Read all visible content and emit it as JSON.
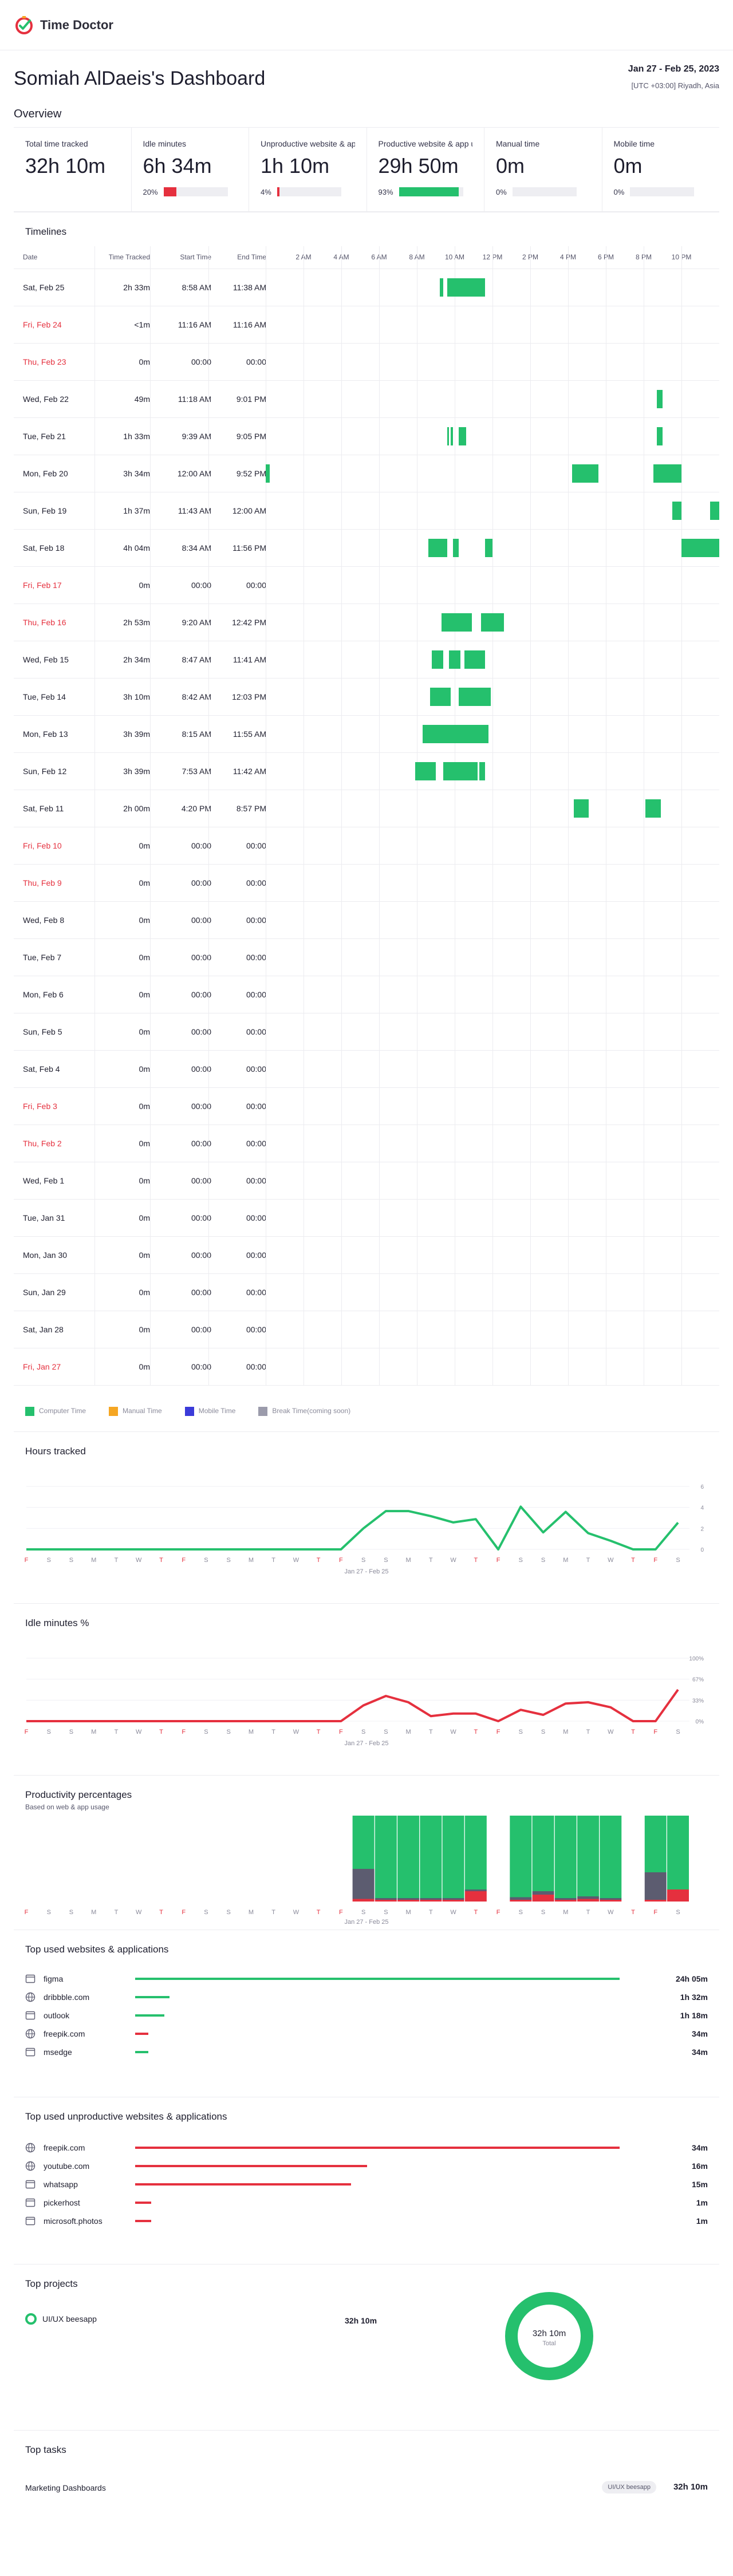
{
  "app": {
    "name": "Time Doctor"
  },
  "header": {
    "title": "Somiah AlDaeis's Dashboard",
    "date_range": "Jan 27 - Feb 25, 2023",
    "timezone": "[UTC +03:00] Riyadh, Asia"
  },
  "overview": {
    "title": "Overview",
    "cards": [
      {
        "label": "Total time tracked",
        "value": "32h 10m"
      },
      {
        "label": "Idle minutes",
        "value": "6h 34m",
        "pct": "20%",
        "fill": 0.2,
        "color": "#e5303e"
      },
      {
        "label": "Unproductive website & apps",
        "value": "1h 10m",
        "pct": "4%",
        "fill": 0.04,
        "color": "#e5303e"
      },
      {
        "label": "Productive website & app usage",
        "value": "29h 50m",
        "pct": "93%",
        "fill": 0.93,
        "color": "#25c06d"
      },
      {
        "label": "Manual time",
        "value": "0m",
        "pct": "0%",
        "fill": 0,
        "color": "#e5303e"
      },
      {
        "label": "Mobile time",
        "value": "0m",
        "pct": "0%",
        "fill": 0,
        "color": "#e5303e"
      }
    ]
  },
  "timelines": {
    "title": "Timelines",
    "columns": [
      "Date",
      "Time Tracked",
      "Start Time",
      "End Time"
    ],
    "hours": [
      "2 AM",
      "4 AM",
      "6 AM",
      "8 AM",
      "10 AM",
      "12 PM",
      "2 PM",
      "4 PM",
      "6 PM",
      "8 PM",
      "10 PM"
    ],
    "rows": [
      {
        "date": "Sat, Feb 25",
        "tracked": "2h 33m",
        "start": "8:58 AM",
        "end": "11:38 AM",
        "weekend": false
      },
      {
        "date": "Fri, Feb 24",
        "tracked": "<1m",
        "start": "11:16 AM",
        "end": "11:16 AM",
        "weekend": true
      },
      {
        "date": "Thu, Feb 23",
        "tracked": "0m",
        "start": "00:00",
        "end": "00:00",
        "weekend": true
      },
      {
        "date": "Wed, Feb 22",
        "tracked": "49m",
        "start": "11:18 AM",
        "end": "9:01 PM",
        "weekend": false
      },
      {
        "date": "Tue, Feb 21",
        "tracked": "1h 33m",
        "start": "9:39 AM",
        "end": "9:05 PM",
        "weekend": false
      },
      {
        "date": "Mon, Feb 20",
        "tracked": "3h 34m",
        "start": "12:00 AM",
        "end": "9:52 PM",
        "weekend": false
      },
      {
        "date": "Sun, Feb 19",
        "tracked": "1h 37m",
        "start": "11:43 AM",
        "end": "12:00 AM",
        "weekend": false
      },
      {
        "date": "Sat, Feb 18",
        "tracked": "4h 04m",
        "start": "8:34 AM",
        "end": "11:56 PM",
        "weekend": false
      },
      {
        "date": "Fri, Feb 17",
        "tracked": "0m",
        "start": "00:00",
        "end": "00:00",
        "weekend": true
      },
      {
        "date": "Thu, Feb 16",
        "tracked": "2h 53m",
        "start": "9:20 AM",
        "end": "12:42 PM",
        "weekend": true
      },
      {
        "date": "Wed, Feb 15",
        "tracked": "2h 34m",
        "start": "8:47 AM",
        "end": "11:41 AM",
        "weekend": false
      },
      {
        "date": "Tue, Feb 14",
        "tracked": "3h 10m",
        "start": "8:42 AM",
        "end": "12:03 PM",
        "weekend": false
      },
      {
        "date": "Mon, Feb 13",
        "tracked": "3h 39m",
        "start": "8:15 AM",
        "end": "11:55 AM",
        "weekend": false
      },
      {
        "date": "Sun, Feb 12",
        "tracked": "3h 39m",
        "start": "7:53 AM",
        "end": "11:42 AM",
        "weekend": false
      },
      {
        "date": "Sat, Feb 11",
        "tracked": "2h 00m",
        "start": "4:20 PM",
        "end": "8:57 PM",
        "weekend": false
      },
      {
        "date": "Fri, Feb 10",
        "tracked": "0m",
        "start": "00:00",
        "end": "00:00",
        "weekend": true
      },
      {
        "date": "Thu, Feb 9",
        "tracked": "0m",
        "start": "00:00",
        "end": "00:00",
        "weekend": true
      },
      {
        "date": "Wed, Feb 8",
        "tracked": "0m",
        "start": "00:00",
        "end": "00:00",
        "weekend": false
      },
      {
        "date": "Tue, Feb 7",
        "tracked": "0m",
        "start": "00:00",
        "end": "00:00",
        "weekend": false
      },
      {
        "date": "Mon, Feb 6",
        "tracked": "0m",
        "start": "00:00",
        "end": "00:00",
        "weekend": false
      },
      {
        "date": "Sun, Feb 5",
        "tracked": "0m",
        "start": "00:00",
        "end": "00:00",
        "weekend": false
      },
      {
        "date": "Sat, Feb 4",
        "tracked": "0m",
        "start": "00:00",
        "end": "00:00",
        "weekend": false
      },
      {
        "date": "Fri, Feb 3",
        "tracked": "0m",
        "start": "00:00",
        "end": "00:00",
        "weekend": true
      },
      {
        "date": "Thu, Feb 2",
        "tracked": "0m",
        "start": "00:00",
        "end": "00:00",
        "weekend": true
      },
      {
        "date": "Wed, Feb 1",
        "tracked": "0m",
        "start": "00:00",
        "end": "00:00",
        "weekend": false
      },
      {
        "date": "Tue, Jan 31",
        "tracked": "0m",
        "start": "00:00",
        "end": "00:00",
        "weekend": false
      },
      {
        "date": "Mon, Jan 30",
        "tracked": "0m",
        "start": "00:00",
        "end": "00:00",
        "weekend": false
      },
      {
        "date": "Sun, Jan 29",
        "tracked": "0m",
        "start": "00:00",
        "end": "00:00",
        "weekend": false
      },
      {
        "date": "Sat, Jan 28",
        "tracked": "0m",
        "start": "00:00",
        "end": "00:00",
        "weekend": false
      },
      {
        "date": "Fri, Jan 27",
        "tracked": "0m",
        "start": "00:00",
        "end": "00:00",
        "weekend": true
      }
    ],
    "segments": [
      [
        [
          9.2,
          9.4
        ],
        [
          9.6,
          11.6
        ]
      ],
      [],
      [],
      [
        [
          20.7,
          21.0
        ]
      ],
      [
        [
          9.6,
          9.7
        ],
        [
          9.8,
          9.9
        ],
        [
          10.2,
          10.6
        ],
        [
          20.7,
          21.0
        ]
      ],
      [
        [
          0,
          0.2
        ],
        [
          16.2,
          17.6
        ],
        [
          20.5,
          22.0
        ]
      ],
      [
        [
          21.5,
          22.0
        ],
        [
          23.5,
          24.0
        ]
      ],
      [
        [
          8.6,
          9.6
        ],
        [
          9.9,
          10.2
        ],
        [
          11.6,
          12.0
        ],
        [
          22.0,
          24.0
        ]
      ],
      [],
      [
        [
          9.3,
          10.9
        ],
        [
          11.4,
          12.6
        ]
      ],
      [
        [
          8.8,
          9.4
        ],
        [
          9.7,
          10.3
        ],
        [
          10.5,
          11.6
        ]
      ],
      [
        [
          8.7,
          9.8
        ],
        [
          10.2,
          11.9
        ]
      ],
      [
        [
          8.3,
          11.8
        ]
      ],
      [
        [
          7.9,
          9.0
        ],
        [
          9.4,
          11.2
        ],
        [
          11.3,
          11.6
        ]
      ],
      [
        [
          16.3,
          17.1
        ],
        [
          20.1,
          20.9
        ]
      ],
      [],
      [],
      [],
      [],
      [],
      [],
      [],
      [],
      [],
      [],
      [],
      [],
      [],
      [],
      []
    ],
    "legend": [
      {
        "label": "Computer Time",
        "color": "#25c06d"
      },
      {
        "label": "Manual Time",
        "color": "#f5a623"
      },
      {
        "label": "Mobile Time",
        "color": "#3b3bd9"
      },
      {
        "label": "Break Time(coming soon)",
        "color": "#9b9bab"
      }
    ]
  },
  "hours_tracked": {
    "title": "Hours tracked",
    "caption": "Jan 27 - Feb 25"
  },
  "idle_minutes": {
    "title": "Idle minutes %",
    "caption": "Jan 27 - Feb 25"
  },
  "productivity": {
    "title": "Productivity percentages",
    "subtitle": "Based on web & app usage",
    "caption": "Jan 27 - Feb 25"
  },
  "chart_data": [
    {
      "type": "line",
      "title": "Hours tracked",
      "x": [
        "F",
        "S",
        "S",
        "M",
        "T",
        "W",
        "T",
        "F",
        "S",
        "S",
        "M",
        "T",
        "W",
        "T",
        "F",
        "S",
        "S",
        "M",
        "T",
        "W",
        "T",
        "F",
        "S",
        "S",
        "M",
        "T",
        "W",
        "T",
        "F",
        "S"
      ],
      "red_days": [
        0,
        6,
        7,
        13,
        14,
        20,
        21,
        27,
        28
      ],
      "values": [
        0,
        0,
        0,
        0,
        0,
        0,
        0,
        0,
        0,
        0,
        0,
        0,
        0,
        0,
        0,
        2.0,
        3.65,
        3.65,
        3.17,
        2.57,
        2.88,
        0,
        4.07,
        1.62,
        3.57,
        1.55,
        0.82,
        0,
        0,
        2.55
      ],
      "yticks": [
        0,
        2,
        4,
        6
      ],
      "ylim": [
        0,
        6
      ],
      "color": "#25c06d"
    },
    {
      "type": "line",
      "title": "Idle minutes %",
      "x": [
        "F",
        "S",
        "S",
        "M",
        "T",
        "W",
        "T",
        "F",
        "S",
        "S",
        "M",
        "T",
        "W",
        "T",
        "F",
        "S",
        "S",
        "M",
        "T",
        "W",
        "T",
        "F",
        "S",
        "S",
        "M",
        "T",
        "W",
        "T",
        "F",
        "S"
      ],
      "red_days": [
        0,
        6,
        7,
        13,
        14,
        20,
        21,
        27,
        28
      ],
      "values": [
        0,
        0,
        0,
        0,
        0,
        0,
        0,
        0,
        0,
        0,
        0,
        0,
        0,
        0,
        0,
        25,
        40,
        30,
        8,
        12,
        12,
        0,
        18,
        10,
        28,
        30,
        22,
        0,
        0,
        50
      ],
      "yticks": [
        "0%",
        "33%",
        "67%",
        "100%"
      ],
      "ylim": [
        0,
        100
      ],
      "color": "#e5303e"
    },
    {
      "type": "bar",
      "title": "Productivity percentages",
      "x": [
        "F",
        "S",
        "S",
        "M",
        "T",
        "W",
        "T",
        "F",
        "S",
        "S",
        "M",
        "T",
        "W",
        "T",
        "F",
        "S",
        "S",
        "M",
        "T",
        "W",
        "T",
        "F",
        "S",
        "S",
        "M",
        "T",
        "W",
        "T",
        "F",
        "S"
      ],
      "red_days": [
        0,
        6,
        7,
        13,
        14,
        20,
        21,
        27,
        28
      ],
      "series": [
        {
          "name": "productive",
          "color": "#25c06d",
          "values": [
            0,
            0,
            0,
            0,
            0,
            0,
            0,
            0,
            0,
            0,
            0,
            0,
            0,
            0,
            0,
            62,
            96,
            96,
            96,
            96,
            86,
            0,
            95,
            88,
            96,
            94,
            96,
            0,
            66,
            86
          ]
        },
        {
          "name": "unproductive",
          "color": "#e5303e",
          "values": [
            0,
            0,
            0,
            0,
            0,
            0,
            0,
            0,
            0,
            0,
            0,
            0,
            0,
            0,
            0,
            3,
            2,
            2,
            2,
            2,
            12,
            0,
            2,
            8,
            2,
            3,
            2,
            0,
            2,
            14
          ]
        },
        {
          "name": "neutral",
          "color": "#5c5c70",
          "values": [
            0,
            0,
            0,
            0,
            0,
            0,
            0,
            0,
            0,
            0,
            0,
            0,
            0,
            0,
            0,
            35,
            2,
            2,
            2,
            2,
            2,
            0,
            3,
            4,
            2,
            3,
            2,
            0,
            32,
            0
          ]
        }
      ]
    }
  ],
  "top_apps": {
    "title": "Top used websites & applications",
    "items": [
      {
        "name": "figma",
        "value": "24h 05m",
        "fill": 0.92,
        "color": "#25c06d",
        "icon": "app-icon"
      },
      {
        "name": "dribbble.com",
        "value": "1h 32m",
        "fill": 0.065,
        "color": "#25c06d",
        "icon": "globe-icon"
      },
      {
        "name": "outlook",
        "value": "1h 18m",
        "fill": 0.055,
        "color": "#25c06d",
        "icon": "app-icon"
      },
      {
        "name": "freepik.com",
        "value": "34m",
        "fill": 0.025,
        "color": "#e5303e",
        "icon": "globe-icon"
      },
      {
        "name": "msedge",
        "value": "34m",
        "fill": 0.025,
        "color": "#25c06d",
        "icon": "app-icon"
      }
    ]
  },
  "top_unproductive": {
    "title": "Top used unproductive websites & applications",
    "items": [
      {
        "name": "freepik.com",
        "value": "34m",
        "fill": 0.92,
        "color": "#e5303e",
        "icon": "globe-icon"
      },
      {
        "name": "youtube.com",
        "value": "16m",
        "fill": 0.44,
        "color": "#e5303e",
        "icon": "globe-icon"
      },
      {
        "name": "whatsapp",
        "value": "15m",
        "fill": 0.41,
        "color": "#e5303e",
        "icon": "app-icon"
      },
      {
        "name": "pickerhost",
        "value": "1m",
        "fill": 0.03,
        "color": "#e5303e",
        "icon": "app-icon"
      },
      {
        "name": "microsoft.photos",
        "value": "1m",
        "fill": 0.03,
        "color": "#e5303e",
        "icon": "app-icon"
      }
    ]
  },
  "top_projects": {
    "title": "Top projects",
    "project": "UI/UX beesapp",
    "time": "32h 10m",
    "donut_value": "32h 10m",
    "donut_label": "Total",
    "share": 1.0,
    "color": "#25c06d"
  },
  "top_tasks": {
    "title": "Top tasks",
    "task": "Marketing Dashboards",
    "project_badge": "UI/UX beesapp",
    "time": "32h 10m"
  }
}
